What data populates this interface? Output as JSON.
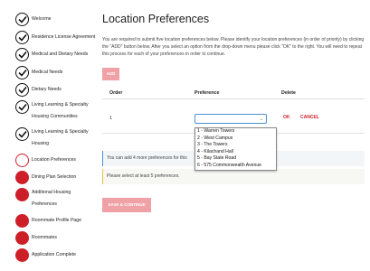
{
  "sidebar": {
    "steps": [
      {
        "label": "Welcome",
        "status": "done"
      },
      {
        "label": "Residence License Agreement",
        "status": "done"
      },
      {
        "label": "Medical and Dietary Needs",
        "status": "done"
      },
      {
        "label": "Medical Needs",
        "status": "done"
      },
      {
        "label": "Dietary Needs",
        "status": "done"
      },
      {
        "label_line1": "Living Learning & Specialty",
        "label_line2": "Housing Communities",
        "status": "done"
      },
      {
        "label_line1": "Living Learning & Specialty",
        "label_line2": "Housing",
        "status": "done"
      },
      {
        "label": "Location Preferences",
        "status": "current"
      },
      {
        "label": "Dining Plan Selection",
        "status": "todo"
      },
      {
        "label_line1": "Additional Housing",
        "label_line2": "Preferences",
        "status": "todo"
      },
      {
        "label": "Roommate Profile Page",
        "status": "todo"
      },
      {
        "label": "Roommates",
        "status": "todo"
      },
      {
        "label": "Application Complete",
        "status": "todo"
      }
    ]
  },
  "main": {
    "title": "Location Preferences",
    "intro": "You are required to submit five location preferences below. Please identify your location preferences (in order of priority) by clicking the \"ADD\" button below. After you select an option from the drop-down menu please click \"OK\" to the right. You will need to repeat this process for each of your preferences in order to continue.",
    "add_label": "ADD",
    "table": {
      "headers": {
        "order": "Order",
        "preference": "Preference",
        "delete": "Delete"
      },
      "row": {
        "order": "1",
        "selected": "",
        "ok_label": "OK",
        "cancel_label": "CANCEL"
      }
    },
    "dropdown_options": [
      "1 - Warren Towers",
      "2 - West Campus",
      "3 - The Towers",
      "4 - Kilachand Hall",
      "5 - Bay State Road",
      "6 - 575 Commonwealth Avenue"
    ],
    "info_message": "You can add 4 more preferences for this",
    "warning_message": "Please select at least 5 preferences.",
    "save_label": "SAVE & CONTINUE"
  },
  "colors": {
    "accent": "#cc1f27",
    "button_disabled": "#f0a1a5",
    "select_border": "#4a90d9",
    "warning_border": "#e8c43a"
  }
}
